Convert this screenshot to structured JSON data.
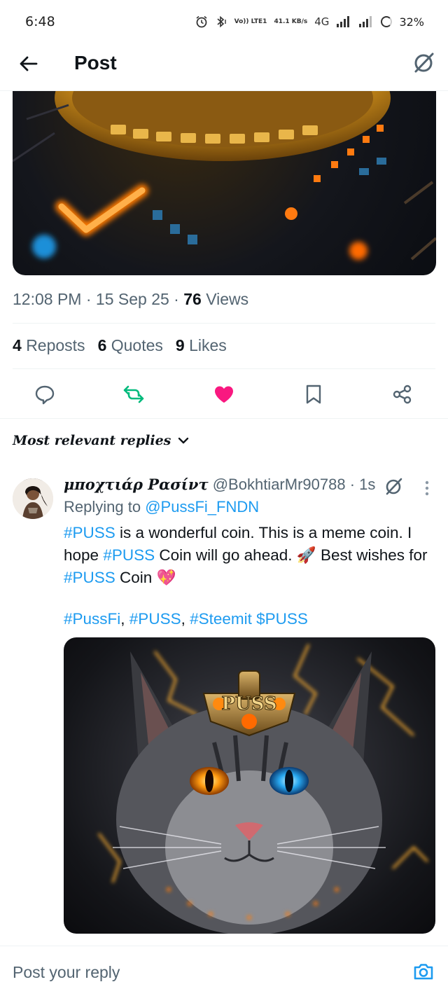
{
  "status_bar": {
    "time": "6:48",
    "volte": "Vo)) LTE1",
    "speed": "41.1 KB/s",
    "network": "4G",
    "battery": "32%"
  },
  "header": {
    "title": "Post"
  },
  "post": {
    "time": "12:08 PM",
    "date": "15 Sep 25",
    "views_count": "76",
    "views_label": "Views",
    "reposts_count": "4",
    "reposts_label": "Reposts",
    "quotes_count": "6",
    "quotes_label": "Quotes",
    "likes_count": "9",
    "likes_label": "Likes"
  },
  "replies": {
    "sort_label": "Most relevant replies",
    "items": [
      {
        "name": "μποχτιάρ Ρασίντ",
        "handle": "@BokhtiarMr90788",
        "age": "1s",
        "replying_prefix": "Replying to",
        "replying_to": "@PussFi_FNDN",
        "tag1": "#PUSS",
        "text1": " is a wonderful coin. This is a meme coin. I hope ",
        "tag2": "#PUSS",
        "text2": " Coin will go ahead. 🚀 Best wishes for ",
        "tag3": "#PUSS",
        "text3": " Coin 💖",
        "hashtags": [
          "#PussFi",
          "#PUSS",
          "#Steemit $PUSS"
        ],
        "image_label": "PUSS"
      }
    ]
  },
  "composer": {
    "placeholder": "Post your reply"
  },
  "colors": {
    "accent": "#1d9bf0",
    "repost_green": "#00ba7c",
    "like_pink": "#f91880",
    "muted": "#536471"
  }
}
